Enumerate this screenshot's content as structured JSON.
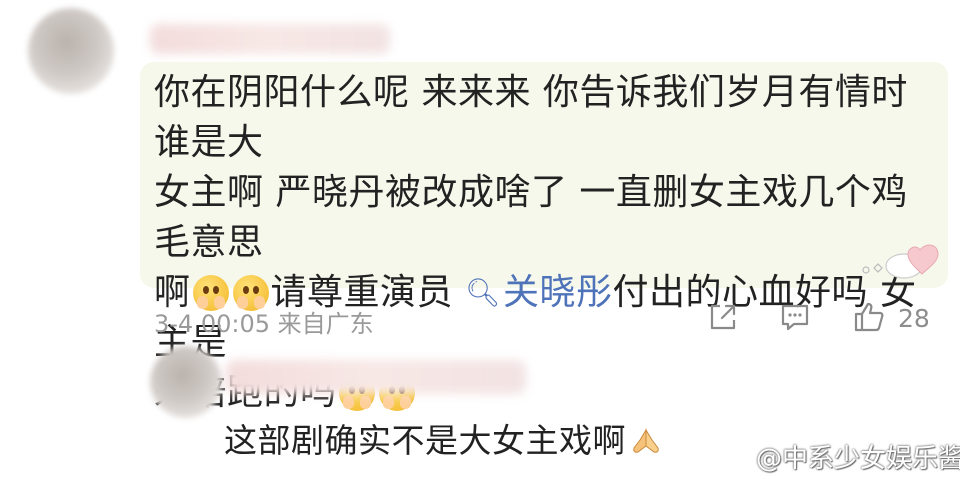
{
  "comment": {
    "text_line1": "你在阴阳什么呢 来来来 你告诉我们岁月有情时谁是大",
    "text_line2": "女主啊 严晓丹被改成啥了 一直删女主戏几个鸡毛意思",
    "text_line3_pre": "啊",
    "text_line3_mid": "请尊重演员",
    "mention": "关晓彤",
    "text_line3_post": "付出的心血好吗 女主是",
    "text_line4": "来陪跑的吗",
    "emojis": [
      "hands-over-mouth-emoji",
      "hands-over-mouth-emoji",
      "praying-face-emoji",
      "praying-face-emoji"
    ],
    "timestamp": "3-4 00:05",
    "location": "来自广东",
    "like_count": "28"
  },
  "reply": {
    "text": "这部剧确实不是大女主戏啊",
    "emoji": "pray-hands-emoji"
  },
  "watermark": {
    "text": "@中系少女娱乐酱",
    "logo": "weibo-logo-icon"
  },
  "colors": {
    "bubble_bg": "#f6f8ec",
    "mention": "#4f73b9",
    "meta_text": "#9a9a9a"
  }
}
